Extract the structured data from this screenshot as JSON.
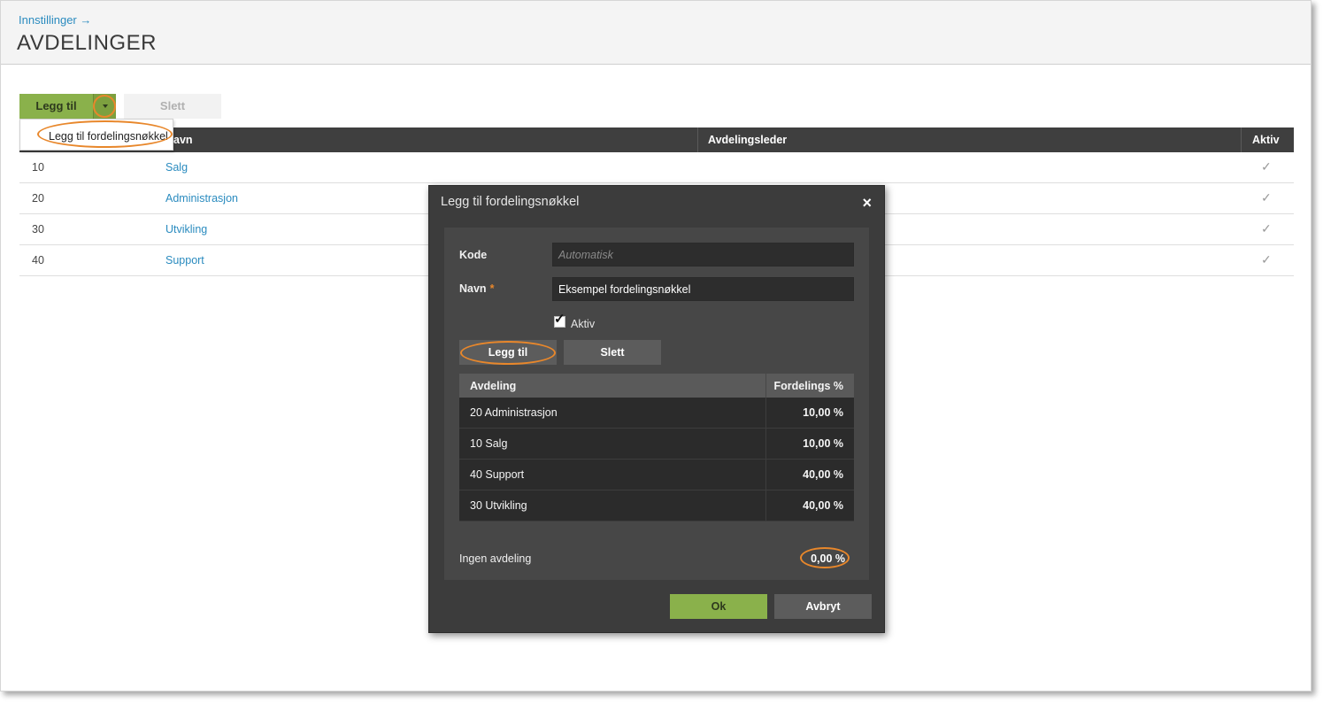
{
  "header": {
    "breadcrumb": "Innstillinger →",
    "title": "AVDELINGER"
  },
  "toolbar": {
    "add_label": "Legg til",
    "delete_label": "Slett",
    "dropdown_item": "Legg til fordelingsnøkkel"
  },
  "grid": {
    "columns": [
      "Navn",
      "Avdelingsleder",
      "Aktiv"
    ],
    "rows": [
      {
        "code": "10",
        "name": "Salg",
        "active": "✓"
      },
      {
        "code": "20",
        "name": "Administrasjon",
        "active": "✓"
      },
      {
        "code": "30",
        "name": "Utvikling",
        "active": "✓"
      },
      {
        "code": "40",
        "name": "Support",
        "active": "✓"
      }
    ]
  },
  "modal": {
    "title": "Legg til fordelingsnøkkel",
    "close": "×",
    "code_label": "Kode",
    "code_placeholder": "Automatisk",
    "name_label": "Navn",
    "required_marker": "*",
    "name_value": "Eksempel fordelingsnøkkel",
    "active_label": "Aktiv",
    "active_checked": true,
    "add_label": "Legg til",
    "delete_label": "Slett",
    "table": {
      "columns": [
        "Avdeling",
        "Fordelings %"
      ],
      "rows": [
        {
          "department": "20 Administrasjon",
          "percent": "10,00 %"
        },
        {
          "department": "10 Salg",
          "percent": "10,00 %"
        },
        {
          "department": "40 Support",
          "percent": "40,00 %"
        },
        {
          "department": "30 Utvikling",
          "percent": "40,00 %"
        }
      ]
    },
    "no_department_label": "Ingen avdeling",
    "no_department_value": "0,00 %",
    "ok_label": "Ok",
    "cancel_label": "Avbryt"
  },
  "colors": {
    "accent_green": "#8ab14b",
    "link_blue": "#2a8bbf",
    "highlight_orange": "#e8872b",
    "modal_bg": "#3c3c3c"
  }
}
